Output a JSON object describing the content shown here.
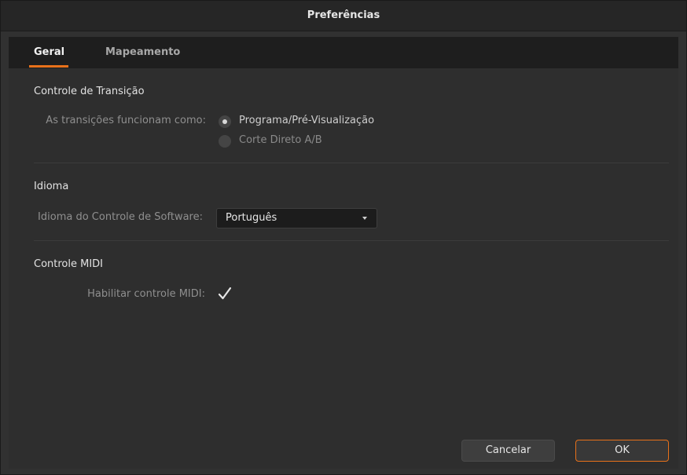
{
  "window": {
    "title": "Preferências"
  },
  "tabs": [
    {
      "label": "Geral",
      "active": true
    },
    {
      "label": "Mapeamento",
      "active": false
    }
  ],
  "transition": {
    "section_title": "Controle de Transição",
    "label": "As transições funcionam como:",
    "options": [
      {
        "label": "Programa/Pré-Visualização",
        "selected": true
      },
      {
        "label": "Corte Direto A/B",
        "selected": false
      }
    ]
  },
  "language": {
    "section_title": "Idioma",
    "label": "Idioma do Controle de Software:",
    "selected": "Português"
  },
  "midi": {
    "section_title": "Controle MIDI",
    "label": "Habilitar controle MIDI:",
    "enabled": true
  },
  "buttons": {
    "cancel": "Cancelar",
    "ok": "OK"
  },
  "colors": {
    "accent": "#e8711a",
    "background": "#2e2e2e"
  }
}
